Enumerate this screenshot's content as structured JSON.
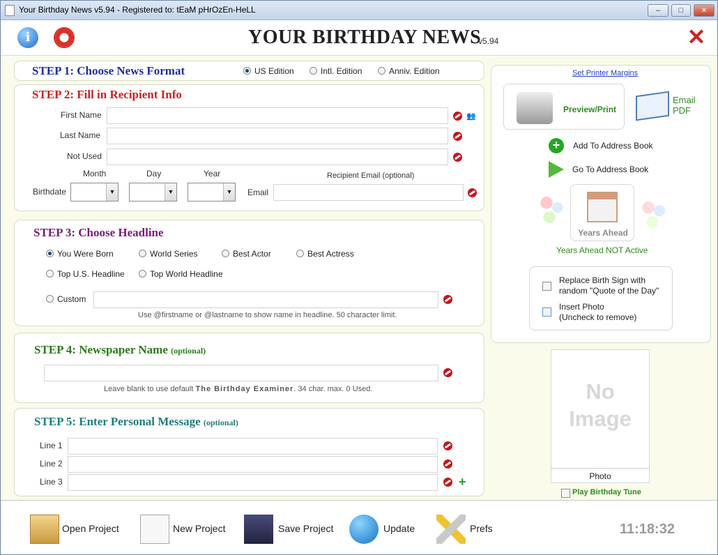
{
  "window": {
    "title": "Your Birthday News v5.94 - Registered to: tEaM pHrOzEn-HeLL"
  },
  "header": {
    "app_name": "YOUR BIRTHDAY NEWS",
    "version": "v5.94"
  },
  "step1": {
    "title": "STEP 1: Choose News Format",
    "options": [
      "US Edition",
      "Intl. Edition",
      "Anniv. Edition"
    ],
    "selected": "US Edition"
  },
  "step2": {
    "title": "STEP 2: Fill in Recipient Info",
    "first_name_label": "First Name",
    "first_name_value": "",
    "last_name_label": "Last Name",
    "last_name_value": "",
    "not_used_label": "Not Used",
    "not_used_value": "",
    "month_label": "Month",
    "day_label": "Day",
    "year_label": "Year",
    "birthdate_label": "Birthdate",
    "email_header": "Recipient Email (optional)",
    "email_label": "Email",
    "email_value": ""
  },
  "step3": {
    "title": "STEP 3: Choose Headline",
    "options": [
      "You Were Born",
      "World Series",
      "Best Actor",
      "Best Actress",
      "Top U.S. Headline",
      "Top World Headline",
      "Custom"
    ],
    "selected": "You Were Born",
    "custom_value": "",
    "hint": "Use @firstname or @lastname to show name in headline. 50 character limit."
  },
  "step4": {
    "title": "STEP 4: Newspaper Name",
    "optional": "(optional)",
    "value": "",
    "hint_prefix": "Leave blank to use default",
    "default_name": "The Birthday Examiner",
    "hint_suffix": ". 34 char. max. 0 Used."
  },
  "step5": {
    "title": "STEP 5: Enter Personal Message",
    "optional": "(optional)",
    "lines": [
      {
        "label": "Line 1",
        "value": ""
      },
      {
        "label": "Line 2",
        "value": ""
      },
      {
        "label": "Line 3",
        "value": ""
      }
    ]
  },
  "right": {
    "printer_margins": "Set Printer Margins",
    "preview_print": "Preview/Print",
    "email_pdf_1": "Email",
    "email_pdf_2": "PDF",
    "add_address_book": "Add To Address Book",
    "go_address_book": "Go To Address Book",
    "years_ahead": "Years Ahead",
    "years_ahead_status": "Years Ahead NOT Active",
    "replace_birth_sign_1": "Replace Birth Sign with",
    "replace_birth_sign_2": "random \"Quote of the Day\"",
    "insert_photo_1": "Insert Photo",
    "insert_photo_2": "(Uncheck to remove)",
    "no_image_1": "No",
    "no_image_2": "Image",
    "photo_label": "Photo",
    "birthday_tune": "Play Birthday Tune"
  },
  "footer": {
    "open": "Open Project",
    "new": "New Project",
    "save": "Save Project",
    "update": "Update",
    "prefs": "Prefs",
    "clock": "11:18:32"
  },
  "colors": {
    "step1": "#1f2f9f",
    "step2": "#d11f1f",
    "step3": "#7a1b7a",
    "step4": "#2a7b1a",
    "step5": "#1f7d7d"
  }
}
